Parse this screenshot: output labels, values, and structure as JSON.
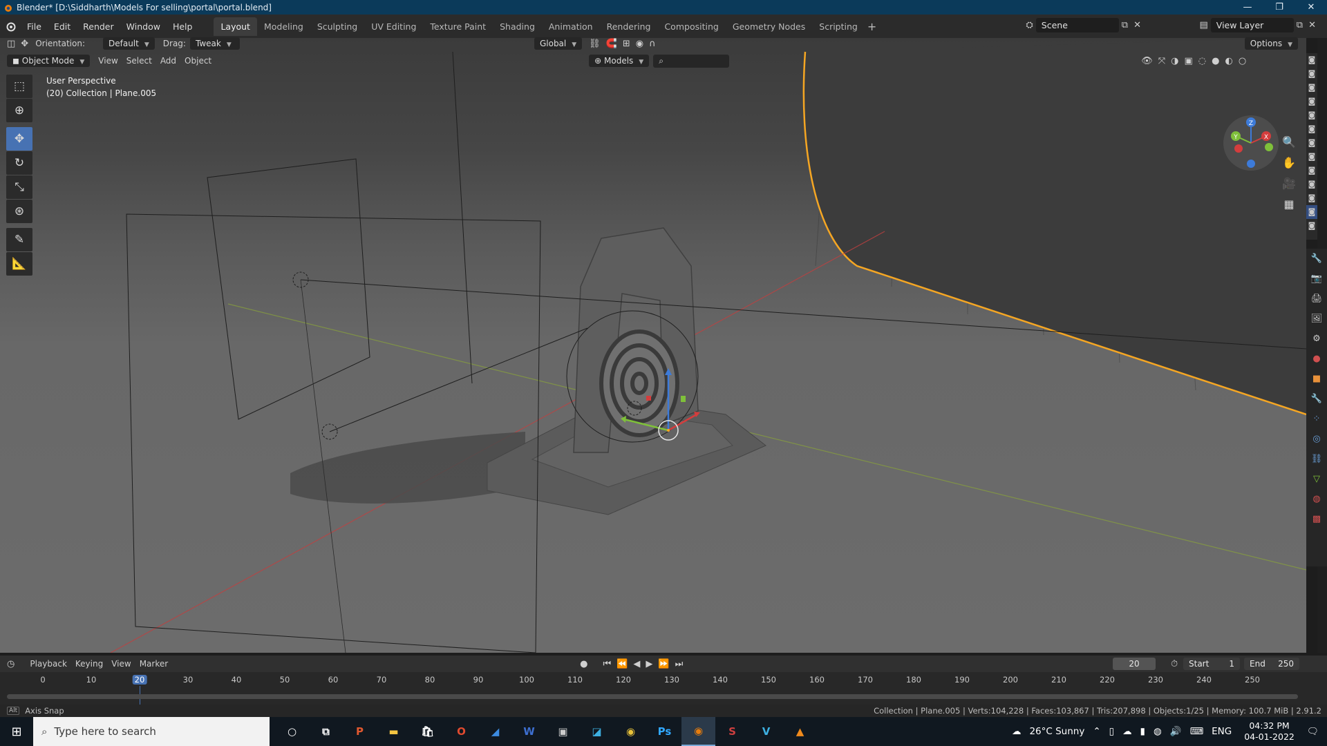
{
  "window": {
    "title": "Blender* [D:\\Siddharth\\Models For selling\\portal\\portal.blend]",
    "minimize": "—",
    "maximize": "❐",
    "close": "✕"
  },
  "menu": [
    "File",
    "Edit",
    "Render",
    "Window",
    "Help"
  ],
  "workspaces": [
    "Layout",
    "Modeling",
    "Sculpting",
    "UV Editing",
    "Texture Paint",
    "Shading",
    "Animation",
    "Rendering",
    "Compositing",
    "Geometry Nodes",
    "Scripting"
  ],
  "active_workspace": "Layout",
  "scene": {
    "name": "Scene",
    "view_layer": "View Layer"
  },
  "tool_header": {
    "orientation_label": "Orientation:",
    "orientation_value": "Default",
    "drag_label": "Drag:",
    "drag_value": "Tweak",
    "transform_space": "Global",
    "options": "Options"
  },
  "viewport_header": {
    "mode": "Object Mode",
    "menus": [
      "View",
      "Select",
      "Add",
      "Object"
    ],
    "filter": "Models"
  },
  "viewport": {
    "perspective": "User Perspective",
    "collection_info": "(20) Collection | Plane.005"
  },
  "gizmo_axes": {
    "x": "X",
    "y": "Y",
    "z": "Z"
  },
  "timeline": {
    "menus": [
      "Playback",
      "Keying",
      "View",
      "Marker"
    ],
    "current_frame": "20",
    "start_label": "Start",
    "start": "1",
    "end_label": "End",
    "end": "250",
    "ticks": [
      "0",
      "10",
      "20",
      "30",
      "40",
      "50",
      "60",
      "70",
      "80",
      "90",
      "100",
      "110",
      "120",
      "130",
      "140",
      "150",
      "160",
      "170",
      "180",
      "190",
      "200",
      "210",
      "220",
      "230",
      "240",
      "250"
    ]
  },
  "status": {
    "left": "Axis Snap",
    "right": "Collection | Plane.005 | Verts:104,228 | Faces:103,867 | Tris:207,898 | Objects:1/25 | Memory: 100.7 MiB | 2.91.2"
  },
  "taskbar": {
    "search_placeholder": "Type here to search",
    "weather": "26°C  Sunny",
    "language": "ENG",
    "time": "04:32 PM",
    "date": "04-01-2022"
  },
  "colors": {
    "accent": "#4772b3",
    "selection_outline": "#f5a623",
    "title_bar": "#0b3a5a"
  }
}
